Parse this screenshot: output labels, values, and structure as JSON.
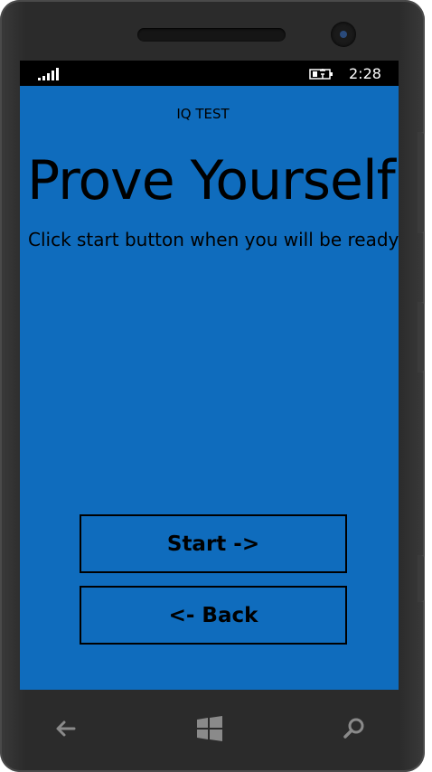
{
  "status_bar": {
    "time": "2:28",
    "signal_icon": "signal-bars-icon",
    "battery_icon": "battery-charging-icon"
  },
  "app": {
    "title": "IQ TEST",
    "headline": "Prove Yourself",
    "subtitle": "Click start button when you will be ready",
    "background_color": "#0f6cbd"
  },
  "buttons": {
    "start_label": "Start ->",
    "back_label": "<- Back"
  },
  "nav_bar": {
    "back_icon": "back-arrow-icon",
    "home_icon": "windows-logo-icon",
    "search_icon": "search-icon"
  }
}
